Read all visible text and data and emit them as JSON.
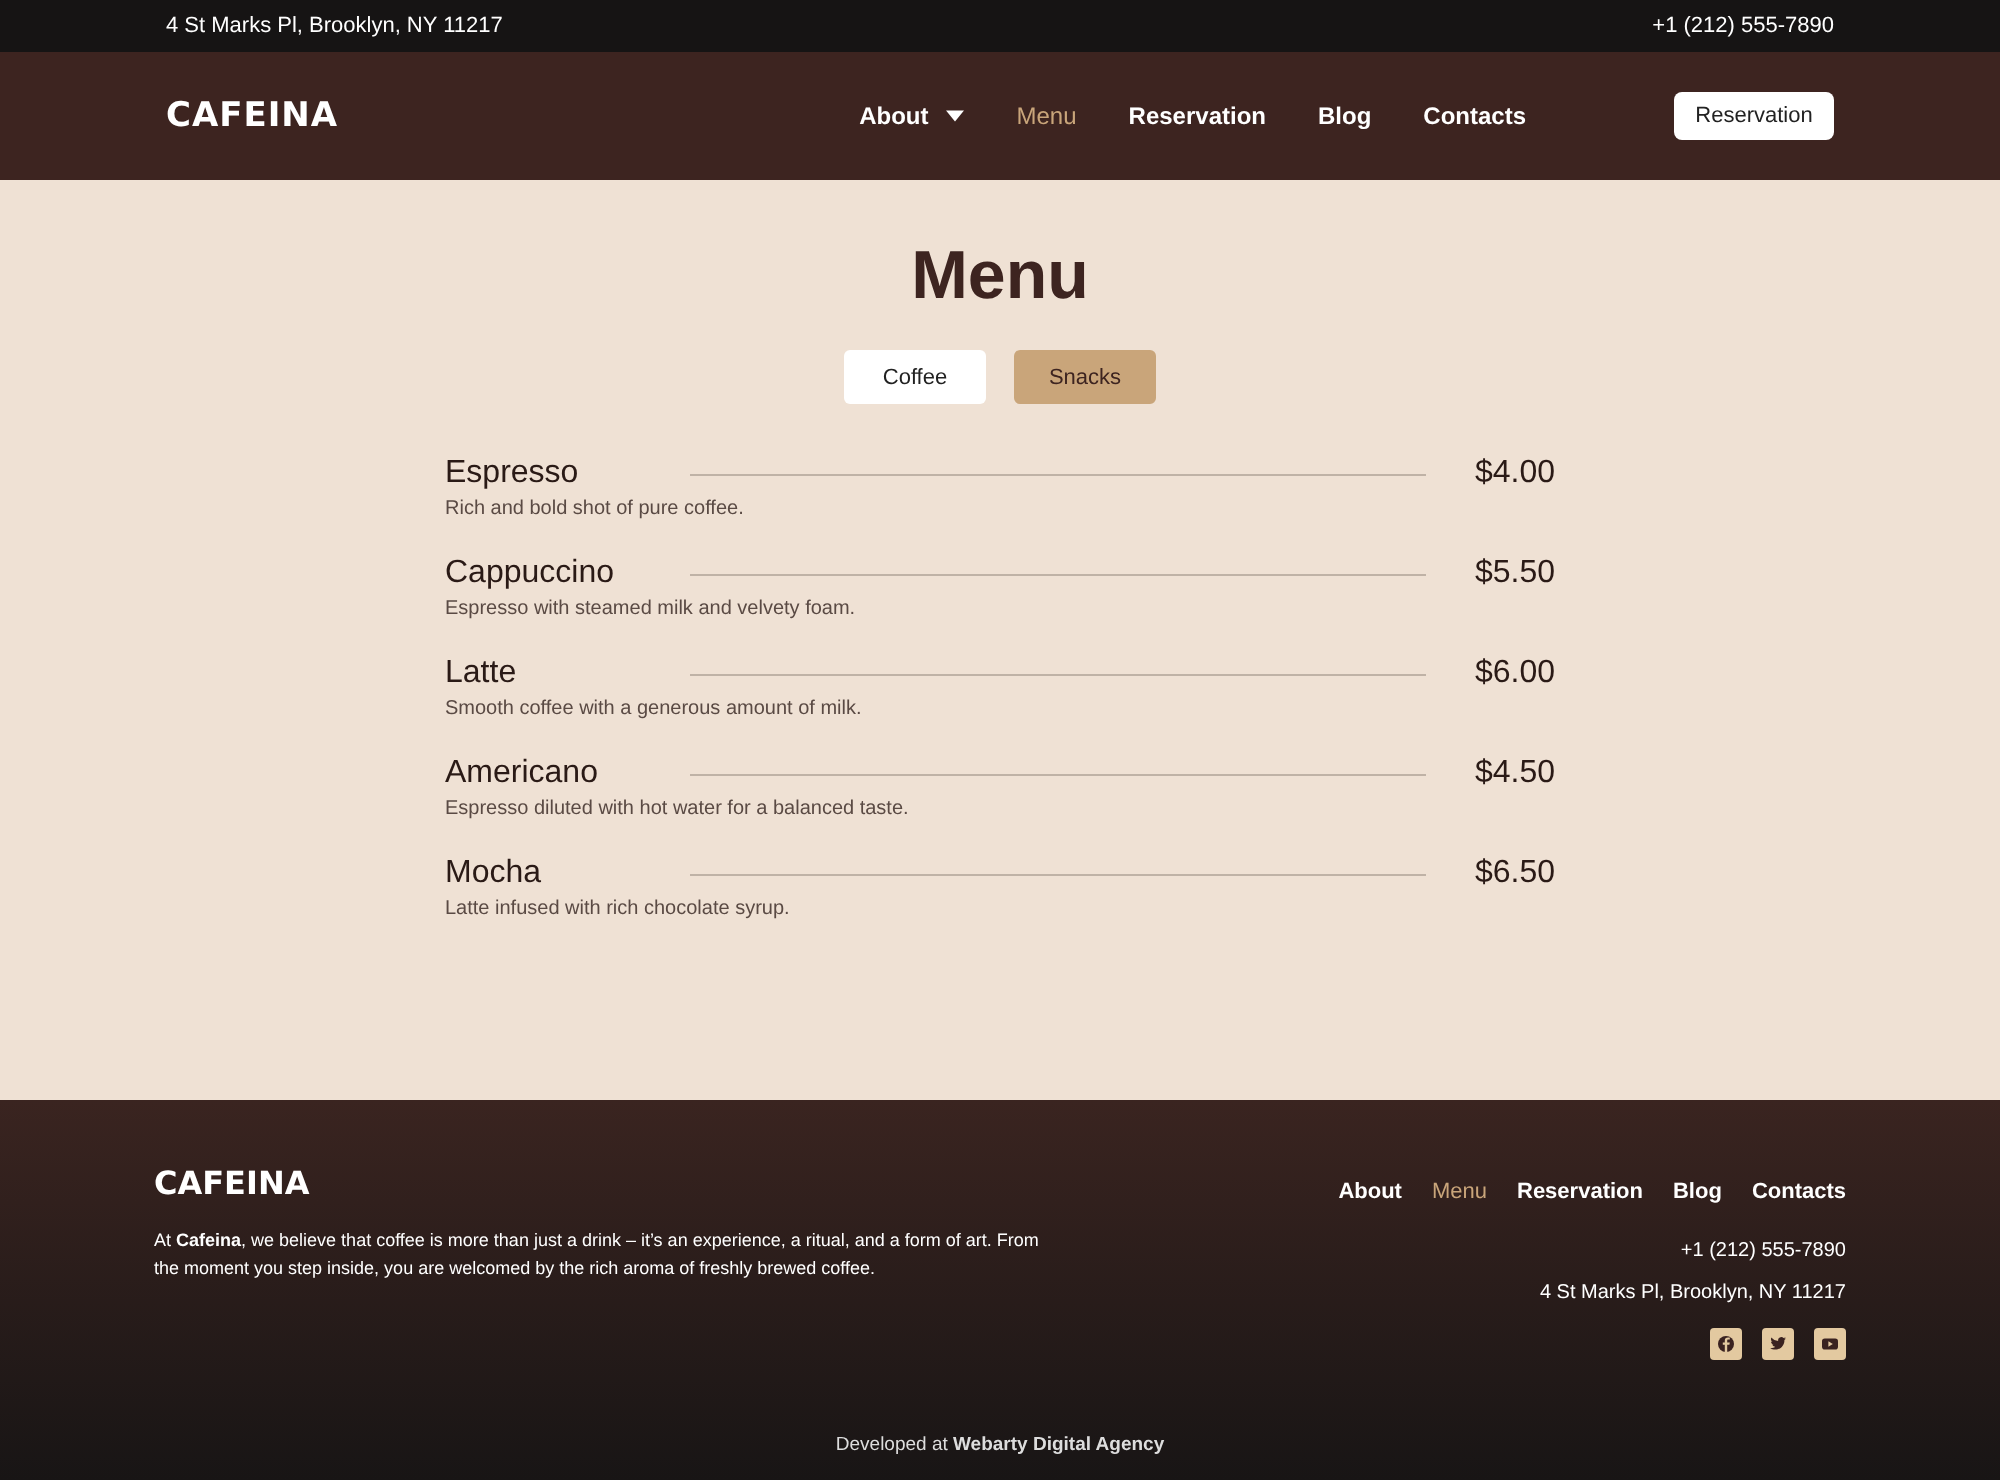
{
  "top_bar": {
    "address": "4 St Marks Pl, Brooklyn, NY 11217",
    "phone": "+1 (212) 555-7890"
  },
  "header": {
    "logo": "CAFEINA",
    "nav": [
      {
        "label": "About",
        "selected": false,
        "dropdown": true
      },
      {
        "label": "Menu",
        "selected": true,
        "dropdown": false
      },
      {
        "label": "Reservation",
        "selected": false,
        "dropdown": false
      },
      {
        "label": "Blog",
        "selected": false,
        "dropdown": false
      },
      {
        "label": "Contacts",
        "selected": false,
        "dropdown": false
      }
    ],
    "button": "Reservation"
  },
  "menu": {
    "title": "Menu",
    "tabs": [
      {
        "label": "Coffee",
        "selected": true
      },
      {
        "label": "Snacks",
        "selected": false
      }
    ],
    "items": [
      {
        "name": "Espresso",
        "price": "$4.00",
        "description": "Rich and bold shot of pure coffee."
      },
      {
        "name": "Cappuccino",
        "price": "$5.50",
        "description": "Espresso with steamed milk and velvety foam."
      },
      {
        "name": "Latte",
        "price": "$6.00",
        "description": "Smooth coffee with a generous amount of milk."
      },
      {
        "name": "Americano",
        "price": "$4.50",
        "description": "Espresso diluted with hot water for a balanced taste."
      },
      {
        "name": "Mocha",
        "price": "$6.50",
        "description": "Latte infused with rich chocolate syrup."
      }
    ]
  },
  "footer": {
    "logo": "CAFEINA",
    "about": "At **Cafeina**, we believe that coffee is more than just a drink – it’s an experience, a ritual, and a form of art. From the moment you step inside, you are welcomed by the rich aroma of freshly brewed coffee.",
    "nav": [
      {
        "label": "About",
        "selected": false
      },
      {
        "label": "Menu",
        "selected": true
      },
      {
        "label": "Reservation",
        "selected": false
      },
      {
        "label": "Blog",
        "selected": false
      },
      {
        "label": "Contacts",
        "selected": false
      }
    ],
    "phone": "+1 (212) 555-7890",
    "address": "4 St Marks Pl, Brooklyn, NY 11217",
    "social": [
      {
        "kind": "facebook"
      },
      {
        "kind": "twitter"
      },
      {
        "kind": "youtube"
      }
    ],
    "credit": "Developed at **Webarty Digital Agency**"
  }
}
